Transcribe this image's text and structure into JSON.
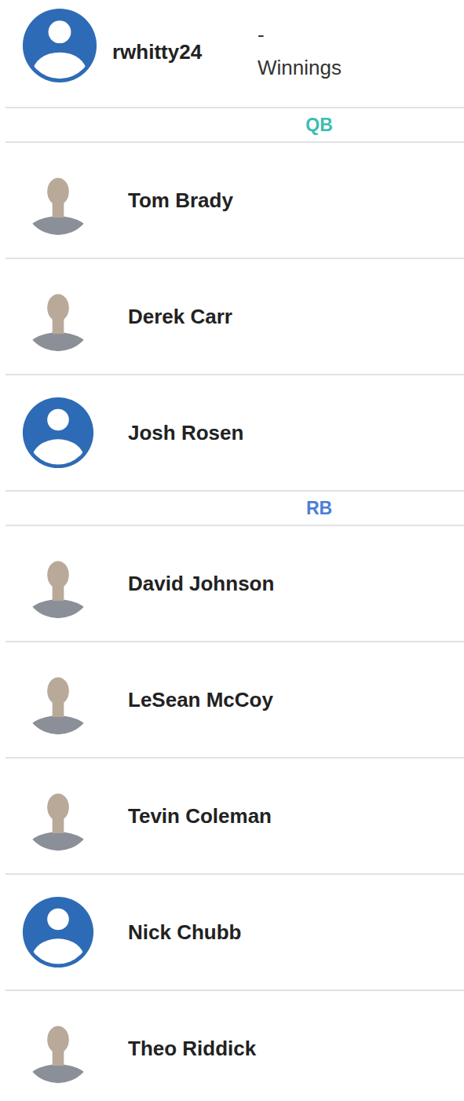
{
  "user": {
    "name": "rwhitty24",
    "winnings_value": "-",
    "winnings_label": "Winnings",
    "kind": "placeholder"
  },
  "sections": [
    {
      "label": "QB",
      "color": "#3bbdb3",
      "players": [
        {
          "name": "Tom Brady",
          "kind": "photo"
        },
        {
          "name": "Derek Carr",
          "kind": "photo"
        },
        {
          "name": "Josh Rosen",
          "kind": "placeholder"
        }
      ]
    },
    {
      "label": "RB",
      "color": "#4a7fd6",
      "players": [
        {
          "name": "David Johnson",
          "kind": "photo"
        },
        {
          "name": "LeSean McCoy",
          "kind": "photo"
        },
        {
          "name": "Tevin Coleman",
          "kind": "photo"
        },
        {
          "name": "Nick Chubb",
          "kind": "placeholder"
        },
        {
          "name": "Theo Riddick",
          "kind": "photo"
        }
      ]
    }
  ]
}
